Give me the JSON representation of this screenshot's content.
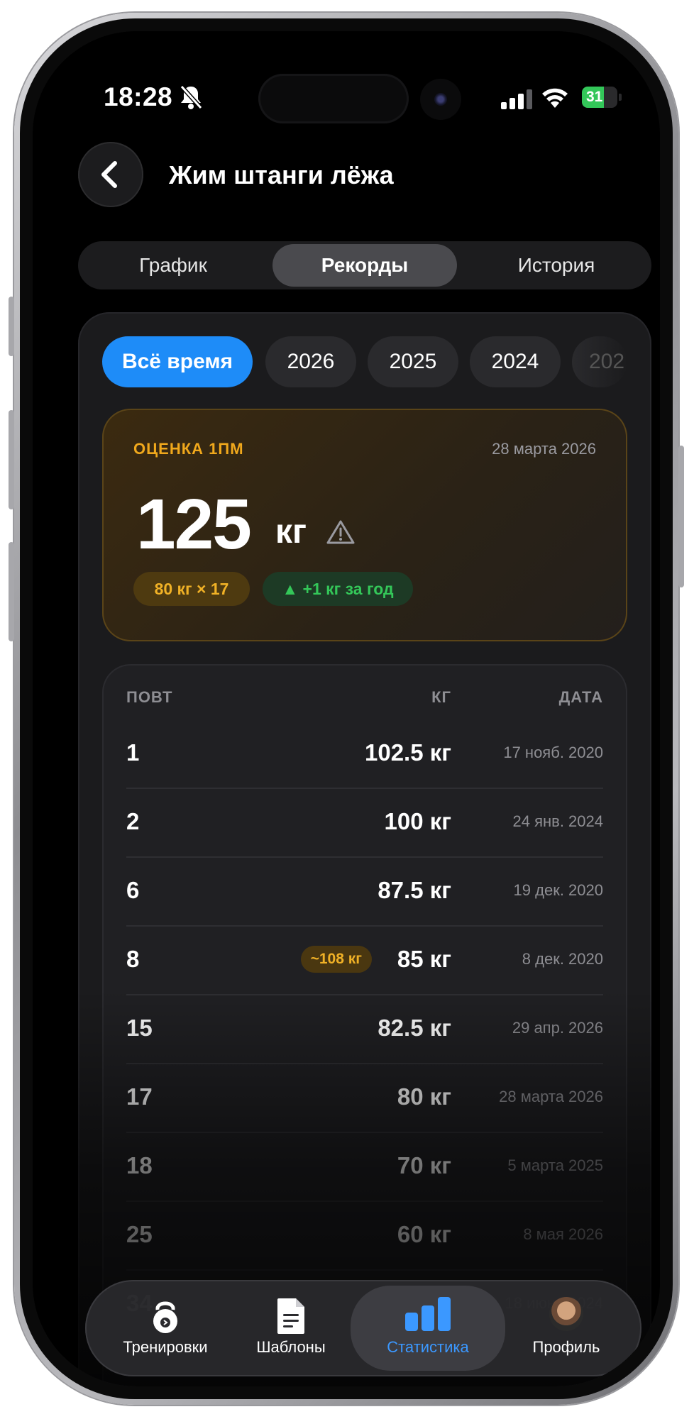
{
  "status_bar": {
    "time": "18:28",
    "battery": "31"
  },
  "header": {
    "title": "Жим штанги лёжа"
  },
  "segments": [
    {
      "label": "График",
      "active": false
    },
    {
      "label": "Рекорды",
      "active": true
    },
    {
      "label": "История",
      "active": false
    }
  ],
  "periods": [
    "Всё время",
    "2026",
    "2025",
    "2024",
    "202"
  ],
  "one_rm": {
    "label": "ОЦЕНКА 1ПМ",
    "date": "28 марта 2026",
    "value": "125",
    "unit": "кг",
    "set_badge": "80 кг × 17",
    "trend_badge": "▲ +1 кг за год"
  },
  "records": {
    "headers": {
      "reps": "ПОВТ",
      "kg": "КГ",
      "date": "ДАТА"
    },
    "rows": [
      {
        "reps": "1",
        "kg": "102.5 кг",
        "date": "17 нояб. 2020"
      },
      {
        "reps": "2",
        "kg": "100 кг",
        "date": "24 янв. 2024"
      },
      {
        "reps": "6",
        "kg": "87.5 кг",
        "date": "19 дек. 2020"
      },
      {
        "reps": "8",
        "kg": "85 кг",
        "date": "8 дек. 2020",
        "estimate": "~108 кг"
      },
      {
        "reps": "15",
        "kg": "82.5 кг",
        "date": "29 апр. 2026"
      },
      {
        "reps": "17",
        "kg": "80 кг",
        "date": "28 марта 2026"
      },
      {
        "reps": "18",
        "kg": "70 кг",
        "date": "5 марта 2025"
      },
      {
        "reps": "25",
        "kg": "60 кг",
        "date": "8 мая 2026"
      },
      {
        "reps": "34",
        "kg": "30 кг",
        "date": "18 июня 2024"
      }
    ]
  },
  "tabbar": [
    {
      "label": "Тренировки",
      "icon": "kettlebell-icon"
    },
    {
      "label": "Шаблоны",
      "icon": "document-icon"
    },
    {
      "label": "Статистика",
      "icon": "bar-chart-icon",
      "active": true
    },
    {
      "label": "Профиль",
      "icon": "avatar"
    }
  ],
  "colors": {
    "accent": "#1e8cf8",
    "amber": "#f0a81c",
    "green": "#34c759",
    "background": "#000000"
  }
}
